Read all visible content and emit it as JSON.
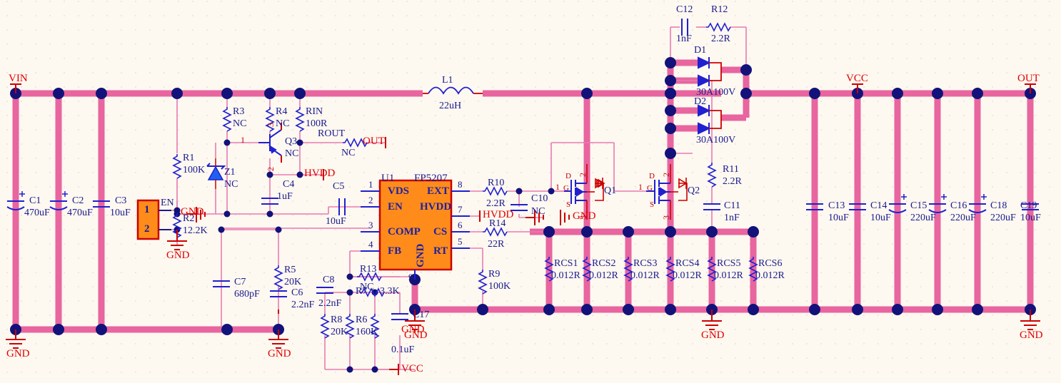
{
  "sheet": {
    "title": "FP5207 Boost Converter Schematic",
    "background_color": "#fdf8f0",
    "wire_thick_color": "#e8659f",
    "wire_thin_color": "#e87cb0",
    "junction_color": "#12127a",
    "symbol_color": "#1a1a8c",
    "net_label_color": "#e00000",
    "component_body_color": "#ff8c1a"
  },
  "net_labels": {
    "vin": "VIN",
    "out_top": "OUT",
    "vcc_top": "VCC",
    "out_right": "OUT",
    "gnd_left": "GND",
    "gnd_left2": "GND",
    "gnd_r2": "GND",
    "gnd_q3": "GND",
    "hvdd_left": "HVDD",
    "hvdd_pin7": "HVDD",
    "gnd_q1": "GND",
    "gnd_rcs": "GND",
    "gnd_u1": "GND",
    "gnd_c17": "GND",
    "vcc_bottom": "VCC",
    "gnd_right": "GND",
    "gnd_mid": "GND"
  },
  "ic": {
    "refdes": "U1",
    "part": "FP5207",
    "pins_left": [
      {
        "num": "1",
        "name": "VDS"
      },
      {
        "num": "2",
        "name": "EN"
      },
      {
        "num": "3",
        "name": "COMP"
      },
      {
        "num": "4",
        "name": "FB"
      }
    ],
    "pins_right": [
      {
        "num": "8",
        "name": "EXT"
      },
      {
        "num": "7",
        "name": "HVDD"
      },
      {
        "num": "6",
        "name": "CS"
      },
      {
        "num": "5",
        "name": "RT"
      }
    ],
    "pin_gnd": {
      "num": "9",
      "name": "GND"
    }
  },
  "connector": {
    "refdes": "EN",
    "pin1": "1",
    "pin2": "2"
  },
  "capacitors": [
    {
      "refdes": "C1",
      "value": "470uF",
      "polarized": true
    },
    {
      "refdes": "C2",
      "value": "470uF",
      "polarized": true
    },
    {
      "refdes": "C3",
      "value": "10uF",
      "polarized": false
    },
    {
      "refdes": "C4",
      "value": "1uF",
      "polarized": false
    },
    {
      "refdes": "C5",
      "value": "10uF",
      "polarized": false
    },
    {
      "refdes": "C6",
      "value": "2.2nF",
      "polarized": false
    },
    {
      "refdes": "C7",
      "value": "680pF",
      "polarized": false
    },
    {
      "refdes": "C8",
      "value": "2.2nF",
      "polarized": false
    },
    {
      "refdes": "C10",
      "value": "NC",
      "polarized": false
    },
    {
      "refdes": "C11",
      "value": "1nF",
      "polarized": false
    },
    {
      "refdes": "C12",
      "value": "1nF",
      "polarized": false
    },
    {
      "refdes": "C13",
      "value": "10uF",
      "polarized": false
    },
    {
      "refdes": "C14",
      "value": "10uF",
      "polarized": false
    },
    {
      "refdes": "C15",
      "value": "220uF",
      "polarized": true
    },
    {
      "refdes": "C16",
      "value": "220uF",
      "polarized": true
    },
    {
      "refdes": "C17",
      "value": "0.1uF",
      "polarized": false
    },
    {
      "refdes": "C18",
      "value": "220uF",
      "polarized": true
    },
    {
      "refdes": "C19",
      "value": "10uF",
      "polarized": false
    }
  ],
  "resistors": [
    {
      "refdes": "R1",
      "value": "100K"
    },
    {
      "refdes": "R2",
      "value": "12.2K"
    },
    {
      "refdes": "R3",
      "value": "NC"
    },
    {
      "refdes": "R4",
      "value": "NC"
    },
    {
      "refdes": "RIN",
      "value": "100R"
    },
    {
      "refdes": "ROUT",
      "value": "NC"
    },
    {
      "refdes": "R5",
      "value": "20K"
    },
    {
      "refdes": "R6",
      "value": "160K"
    },
    {
      "refdes": "R7",
      "value": "3.3K"
    },
    {
      "refdes": "R8",
      "value": "20K"
    },
    {
      "refdes": "R9",
      "value": "100K"
    },
    {
      "refdes": "R10",
      "value": "2.2R"
    },
    {
      "refdes": "R11",
      "value": "2.2R"
    },
    {
      "refdes": "R12",
      "value": "2.2R"
    },
    {
      "refdes": "R13",
      "value": "NC"
    },
    {
      "refdes": "R14",
      "value": "22R"
    },
    {
      "refdes": "RCS1",
      "value": "0.012R"
    },
    {
      "refdes": "RCS2",
      "value": "0.012R"
    },
    {
      "refdes": "RCS3",
      "value": "0.012R"
    },
    {
      "refdes": "RCS4",
      "value": "0.012R"
    },
    {
      "refdes": "RCS5",
      "value": "0.012R"
    },
    {
      "refdes": "RCS6",
      "value": "0.012R"
    }
  ],
  "inductor": {
    "refdes": "L1",
    "value": "22uH"
  },
  "diodes": [
    {
      "refdes": "D1",
      "value": "30A100V"
    },
    {
      "refdes": "D2",
      "value": "30A100V"
    }
  ],
  "zener": {
    "refdes": "Z1",
    "value": "NC"
  },
  "transistors": [
    {
      "refdes": "Q3",
      "value": "NC",
      "type": "pnp",
      "pins": [
        "1",
        "3",
        "2"
      ]
    },
    {
      "refdes": "Q1",
      "type": "nmos",
      "pin_g": "1",
      "pin_d": "2",
      "pin_s": "3",
      "g_label": "G",
      "d_label": "D",
      "s_label": "S"
    },
    {
      "refdes": "Q2",
      "type": "nmos",
      "pin_g": "1",
      "pin_d": "2",
      "pin_s": "3",
      "g_label": "G",
      "d_label": "D",
      "s_label": "S"
    }
  ]
}
